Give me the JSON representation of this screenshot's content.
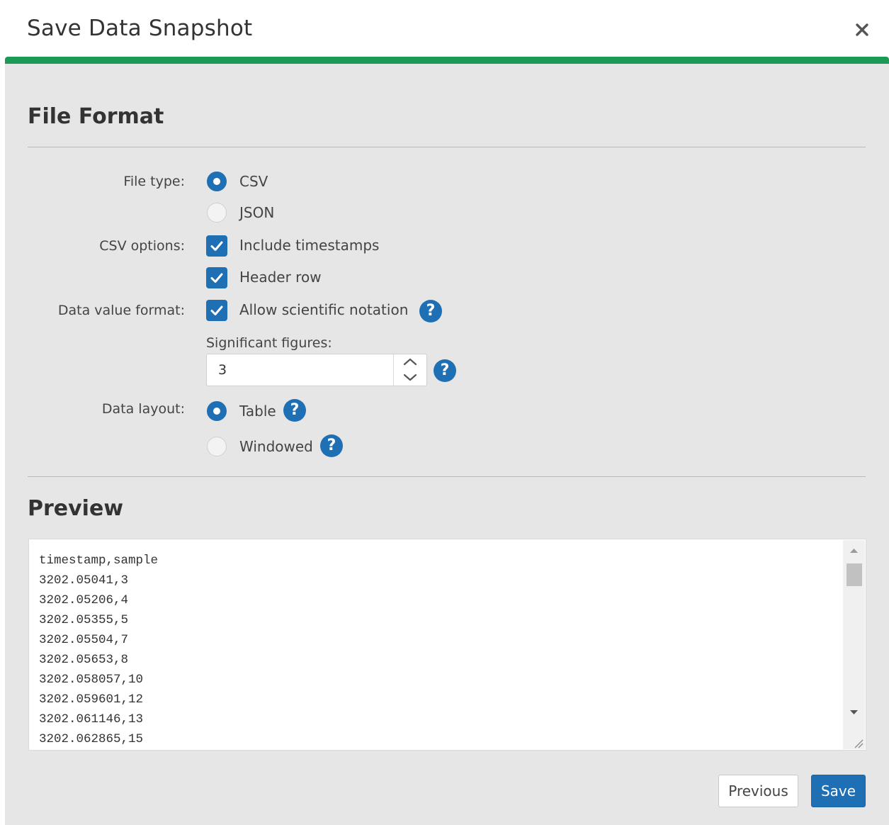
{
  "dialog": {
    "title": "Save Data Snapshot",
    "close_icon": "close-icon",
    "accent_color": "#1a9a55"
  },
  "file_format": {
    "heading": "File Format",
    "file_type": {
      "label": "File type:",
      "options": [
        {
          "label": "CSV",
          "selected": true
        },
        {
          "label": "JSON",
          "selected": false
        }
      ]
    },
    "csv_options": {
      "label": "CSV options:",
      "options": [
        {
          "label": "Include timestamps",
          "checked": true
        },
        {
          "label": "Header row",
          "checked": true
        }
      ]
    },
    "data_value_format": {
      "label": "Data value format:",
      "scientific_notation": {
        "label": "Allow scientific notation",
        "checked": true
      },
      "significant_figures": {
        "label": "Significant figures:",
        "value": "3"
      }
    },
    "data_layout": {
      "label": "Data layout:",
      "options": [
        {
          "label": "Table",
          "selected": true
        },
        {
          "label": "Windowed",
          "selected": false
        }
      ]
    }
  },
  "preview": {
    "heading": "Preview",
    "content": "timestamp,sample\n3202.05041,3\n3202.05206,4\n3202.05355,5\n3202.05504,7\n3202.05653,8\n3202.058057,10\n3202.059601,12\n3202.061146,13\n3202.062865,15"
  },
  "footer": {
    "previous_label": "Previous",
    "save_label": "Save"
  },
  "colors": {
    "primary": "#1e6fb4",
    "body_background": "#e6e6e6"
  }
}
